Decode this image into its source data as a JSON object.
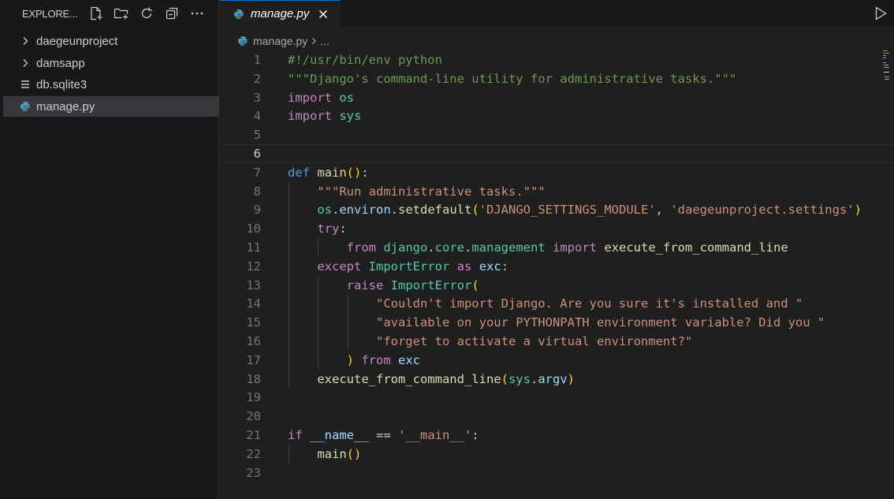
{
  "explorer": {
    "title": "EXPLORE...",
    "items": [
      {
        "label": "daegeunproject",
        "type": "folder",
        "selected": false
      },
      {
        "label": "damsapp",
        "type": "folder",
        "selected": false
      },
      {
        "label": "db.sqlite3",
        "type": "file",
        "selected": false
      },
      {
        "label": "manage.py",
        "type": "python-file",
        "selected": true
      }
    ]
  },
  "tab": {
    "label": "manage.py"
  },
  "breadcrumb": {
    "file": "manage.py",
    "more": "..."
  },
  "colors": {
    "accent": "#0078d4",
    "python_icon": "#519aba"
  },
  "editor": {
    "current_line": 6,
    "lines": [
      {
        "n": "1",
        "tokens": [
          [
            "cm",
            "#!/usr/bin/env python"
          ]
        ]
      },
      {
        "n": "2",
        "tokens": [
          [
            "cm",
            "\"\"\"Django's command-line utility for administrative tasks.\"\"\""
          ]
        ]
      },
      {
        "n": "3",
        "tokens": [
          [
            "kw",
            "import"
          ],
          [
            "pl",
            " "
          ],
          [
            "cls",
            "os"
          ]
        ]
      },
      {
        "n": "4",
        "tokens": [
          [
            "kw",
            "import"
          ],
          [
            "pl",
            " "
          ],
          [
            "cls",
            "sys"
          ]
        ]
      },
      {
        "n": "5",
        "tokens": []
      },
      {
        "n": "6",
        "tokens": []
      },
      {
        "n": "7",
        "tokens": [
          [
            "kwb",
            "def"
          ],
          [
            "pl",
            " "
          ],
          [
            "fn",
            "main"
          ],
          [
            "br1",
            "()"
          ],
          [
            "pl",
            ":"
          ]
        ]
      },
      {
        "n": "8",
        "tokens": [
          [
            "pl",
            "    "
          ],
          [
            "str",
            "\"\"\"Run administrative tasks.\"\"\""
          ]
        ]
      },
      {
        "n": "9",
        "tokens": [
          [
            "pl",
            "    "
          ],
          [
            "cls",
            "os"
          ],
          [
            "pl",
            "."
          ],
          [
            "var",
            "environ"
          ],
          [
            "pl",
            "."
          ],
          [
            "fn",
            "setdefault"
          ],
          [
            "br1",
            "("
          ],
          [
            "str",
            "'DJANGO_SETTINGS_MODULE'"
          ],
          [
            "pl",
            ", "
          ],
          [
            "str",
            "'daegeunproject.settings'"
          ],
          [
            "br1",
            ")"
          ]
        ]
      },
      {
        "n": "10",
        "tokens": [
          [
            "pl",
            "    "
          ],
          [
            "kw",
            "try"
          ],
          [
            "pl",
            ":"
          ]
        ]
      },
      {
        "n": "11",
        "tokens": [
          [
            "pl",
            "        "
          ],
          [
            "kw",
            "from"
          ],
          [
            "pl",
            " "
          ],
          [
            "cls",
            "django"
          ],
          [
            "pl",
            "."
          ],
          [
            "cls",
            "core"
          ],
          [
            "pl",
            "."
          ],
          [
            "cls",
            "management"
          ],
          [
            "pl",
            " "
          ],
          [
            "kw",
            "import"
          ],
          [
            "pl",
            " "
          ],
          [
            "fn",
            "execute_from_command_line"
          ]
        ]
      },
      {
        "n": "12",
        "tokens": [
          [
            "pl",
            "    "
          ],
          [
            "kw",
            "except"
          ],
          [
            "pl",
            " "
          ],
          [
            "cls",
            "ImportError"
          ],
          [
            "pl",
            " "
          ],
          [
            "kw",
            "as"
          ],
          [
            "pl",
            " "
          ],
          [
            "var",
            "exc"
          ],
          [
            "pl",
            ":"
          ]
        ]
      },
      {
        "n": "13",
        "tokens": [
          [
            "pl",
            "        "
          ],
          [
            "kw",
            "raise"
          ],
          [
            "pl",
            " "
          ],
          [
            "cls",
            "ImportError"
          ],
          [
            "br1",
            "("
          ]
        ]
      },
      {
        "n": "14",
        "tokens": [
          [
            "pl",
            "            "
          ],
          [
            "str",
            "\"Couldn't import Django. Are you sure it's installed and \""
          ]
        ]
      },
      {
        "n": "15",
        "tokens": [
          [
            "pl",
            "            "
          ],
          [
            "str",
            "\"available on your PYTHONPATH environment variable? Did you \""
          ]
        ]
      },
      {
        "n": "16",
        "tokens": [
          [
            "pl",
            "            "
          ],
          [
            "str",
            "\"forget to activate a virtual environment?\""
          ]
        ]
      },
      {
        "n": "17",
        "tokens": [
          [
            "pl",
            "        "
          ],
          [
            "br1",
            ")"
          ],
          [
            "pl",
            " "
          ],
          [
            "kw",
            "from"
          ],
          [
            "pl",
            " "
          ],
          [
            "var",
            "exc"
          ]
        ]
      },
      {
        "n": "18",
        "tokens": [
          [
            "pl",
            "    "
          ],
          [
            "fn",
            "execute_from_command_line"
          ],
          [
            "br1",
            "("
          ],
          [
            "cls",
            "sys"
          ],
          [
            "pl",
            "."
          ],
          [
            "var",
            "argv"
          ],
          [
            "br1",
            ")"
          ]
        ]
      },
      {
        "n": "19",
        "tokens": []
      },
      {
        "n": "20",
        "tokens": []
      },
      {
        "n": "21",
        "tokens": [
          [
            "kw",
            "if"
          ],
          [
            "pl",
            " "
          ],
          [
            "var",
            "__name__"
          ],
          [
            "pl",
            " == "
          ],
          [
            "str",
            "'__main__'"
          ],
          [
            "pl",
            ":"
          ]
        ]
      },
      {
        "n": "22",
        "tokens": [
          [
            "pl",
            "    "
          ],
          [
            "fn",
            "main"
          ],
          [
            "br1",
            "()"
          ]
        ]
      },
      {
        "n": "23",
        "tokens": []
      }
    ]
  }
}
